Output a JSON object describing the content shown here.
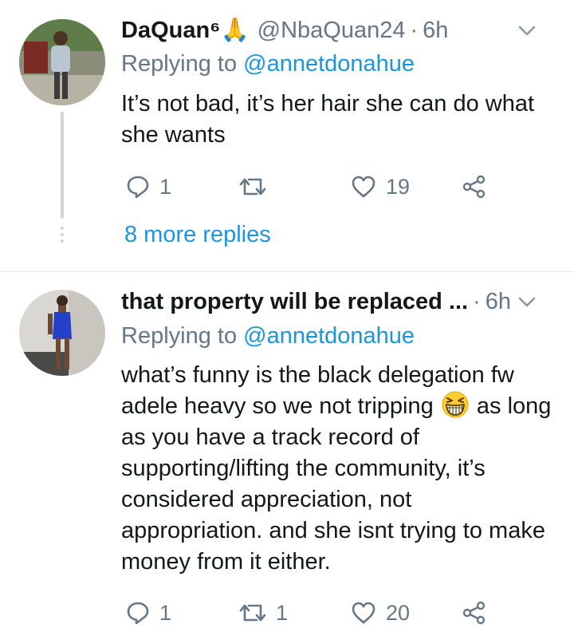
{
  "tweets": [
    {
      "display_name": "DaQuan⁶🙏",
      "handle": "@NbaQuan24",
      "time": "6h",
      "replying_prefix": "Replying to",
      "replying_to": "@annetdonahue",
      "text": "It’s not bad, it’s her hair she can do what she wants",
      "reply_count": "1",
      "retweet_count": "",
      "like_count": "19",
      "more_replies": "8 more replies"
    },
    {
      "display_name": "that property will be replaced ...",
      "time": "6h",
      "replying_prefix": "Replying to",
      "replying_to": "@annetdonahue",
      "text_before_emoji": "what’s funny is the black delegation fw adele heavy so we not tripping",
      "text_after_emoji": "as long as you have a track record of supporting/lifting the community, it’s considered appreciation, not appropriation. and she isnt trying to make money from it either.",
      "emoji": "grinning-squinting-face",
      "reply_count": "1",
      "retweet_count": "1",
      "like_count": "20"
    }
  ],
  "colors": {
    "text": "#14171a",
    "secondary": "#657786",
    "link": "#1b95e0",
    "divider": "#e1e8ed",
    "thread_line": "#ccd6dd"
  },
  "icons": [
    "reply-icon",
    "retweet-icon",
    "like-icon",
    "share-icon",
    "chevron-down-icon"
  ]
}
